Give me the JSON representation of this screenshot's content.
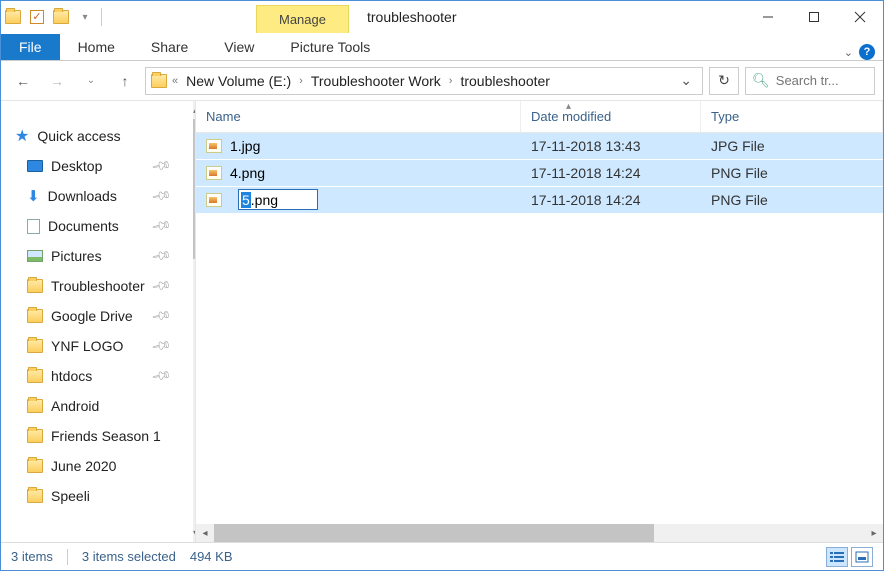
{
  "titlebar": {
    "context_tab": "Manage",
    "window_title": "troubleshooter"
  },
  "ribbon": {
    "file": "File",
    "tabs": [
      "Home",
      "Share",
      "View"
    ],
    "context_tab": "Picture Tools"
  },
  "address": {
    "crumbs": [
      "New Volume (E:)",
      "Troubleshooter Work",
      "troubleshooter"
    ],
    "search_placeholder": "Search tr..."
  },
  "nav": {
    "quick_access": "Quick access",
    "items": [
      {
        "label": "Desktop",
        "icon": "monitor",
        "pinned": true
      },
      {
        "label": "Downloads",
        "icon": "down",
        "pinned": true
      },
      {
        "label": "Documents",
        "icon": "doc",
        "pinned": true
      },
      {
        "label": "Pictures",
        "icon": "pic",
        "pinned": true
      },
      {
        "label": "Troubleshooter",
        "icon": "folder",
        "pinned": true
      },
      {
        "label": "Google Drive",
        "icon": "folder",
        "pinned": true
      },
      {
        "label": "YNF LOGO",
        "icon": "folder",
        "pinned": true
      },
      {
        "label": "htdocs",
        "icon": "folder",
        "pinned": true
      },
      {
        "label": "Android",
        "icon": "folder",
        "pinned": false
      },
      {
        "label": "Friends Season 1",
        "icon": "folder",
        "pinned": false
      },
      {
        "label": "June 2020",
        "icon": "folder",
        "pinned": false
      },
      {
        "label": "Speeli",
        "icon": "folder",
        "pinned": false
      }
    ]
  },
  "columns": {
    "name": "Name",
    "date": "Date modified",
    "type": "Type"
  },
  "files": [
    {
      "name": "1.jpg",
      "date": "17-11-2018 13:43",
      "type": "JPG File"
    },
    {
      "name": "4.png",
      "date": "17-11-2018 14:24",
      "type": "PNG File"
    },
    {
      "name": "5.png",
      "date": "17-11-2018 14:24",
      "type": "PNG File"
    }
  ],
  "rename": {
    "selected": "5",
    "rest": ".png"
  },
  "status": {
    "count": "3 items",
    "selection": "3 items selected",
    "size": "494 KB"
  }
}
